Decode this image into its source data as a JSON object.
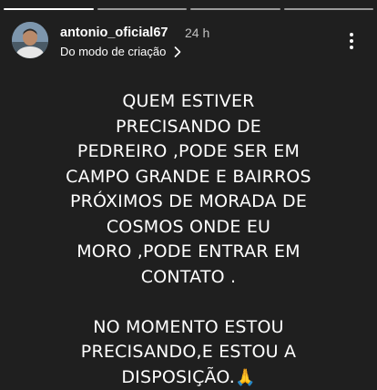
{
  "story": {
    "username": "antonio_oficial67",
    "time_ago": "24 h",
    "source_label": "Do modo de criação",
    "progress_segments": 4,
    "current_segment": 1
  },
  "caption": {
    "lines": [
      "QUEM ESTIVER",
      "PRECISANDO DE",
      "PEDREIRO ,PODE SER EM",
      "CAMPO GRANDE E BAIRROS",
      "PRÓXIMOS DE MORADA DE",
      "COSMOS ONDE EU",
      "MORO ,PODE ENTRAR EM",
      "CONTATO .",
      "",
      "NO MOMENTO ESTOU",
      "PRECISANDO,E ESTOU A",
      "DISPOSIÇÃO."
    ],
    "emoji": "🙏"
  },
  "icons": {
    "chevron": "chevron-right-icon",
    "more": "more-vertical-icon",
    "emoji": "praying-hands-icon"
  },
  "colors": {
    "background": "#1f1f1f",
    "text": "#ffffff",
    "progress_inactive": "#8c8c8c"
  }
}
